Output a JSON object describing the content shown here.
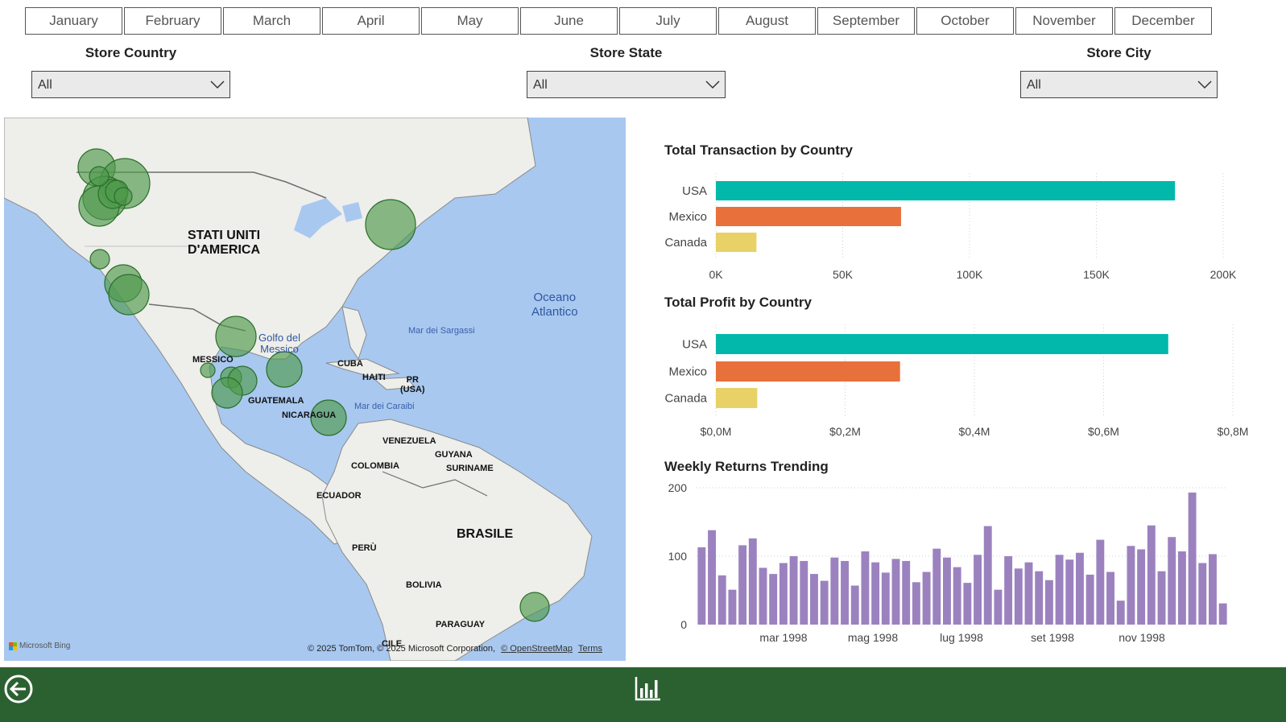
{
  "months": [
    "January",
    "February",
    "March",
    "April",
    "May",
    "June",
    "July",
    "August",
    "September",
    "October",
    "November",
    "December"
  ],
  "slicers": [
    {
      "title": "Store Country",
      "value": "All"
    },
    {
      "title": "Store State",
      "value": "All"
    },
    {
      "title": "Store City",
      "value": "All"
    }
  ],
  "map": {
    "labels": {
      "usa_line1": "STATI UNITI",
      "usa_line2": "D'AMERICA",
      "ocean_line1": "Oceano",
      "ocean_line2": "Atlantico",
      "gulf_line1": "Golfo del",
      "gulf_line2": "Messico",
      "sargasso": "Mar dei Sargassi",
      "caribbean": "Mar dei Caraibi",
      "mexico": "MESSICO",
      "cuba": "CUBA",
      "haiti": "HAITI",
      "pr_line1": "PR",
      "pr_line2": "(USA)",
      "guatemala": "GUATEMALA",
      "nicaragua": "NICARAGUA",
      "venezuela": "VENEZUELA",
      "guyana": "GUYANA",
      "suriname": "SURINAME",
      "colombia": "COLOMBIA",
      "ecuador": "ECUADOR",
      "brazil": "BRASILE",
      "peru": "PERÙ",
      "bolivia": "BOLIVIA",
      "paraguay": "PARAGUAY",
      "chile": "CILE"
    },
    "bing_label": "Microsoft Bing",
    "copyright": "© 2025 TomTom, © 2025 Microsoft Corporation,",
    "osm_link": "© OpenStreetMap",
    "terms_link": "Terms",
    "bubble_color": "#4e9a4b"
  },
  "chart_data": [
    {
      "type": "bar",
      "orientation": "horizontal",
      "title": "Total Transaction by Country",
      "categories": [
        "USA",
        "Mexico",
        "Canada"
      ],
      "values": [
        181000,
        73000,
        16000
      ],
      "colors": [
        "#01b8aa",
        "#e8703a",
        "#e8d166"
      ],
      "xlim": [
        0,
        200000
      ],
      "ticks": [
        "0K",
        "50K",
        "100K",
        "150K",
        "200K"
      ]
    },
    {
      "type": "bar",
      "orientation": "horizontal",
      "title": "Total Profit by Country",
      "categories": [
        "USA",
        "Mexico",
        "Canada"
      ],
      "values": [
        0.7,
        0.285,
        0.064
      ],
      "colors": [
        "#01b8aa",
        "#e8703a",
        "#e8d166"
      ],
      "xlim": [
        0,
        0.8
      ],
      "ticks": [
        "$0,0M",
        "$0,2M",
        "$0,4M",
        "$0,6M",
        "$0,8M"
      ]
    },
    {
      "type": "bar",
      "title": "Weekly Returns Trending",
      "color": "#9b82bf",
      "ylim": [
        0,
        200
      ],
      "yticks": [
        "0",
        "100",
        "200"
      ],
      "x_tick_labels": [
        "mar 1998",
        "mag 1998",
        "lug 1998",
        "set 1998",
        "nov 1998"
      ],
      "values": [
        113,
        138,
        72,
        51,
        116,
        126,
        83,
        74,
        90,
        100,
        93,
        74,
        64,
        98,
        93,
        57,
        107,
        91,
        76,
        96,
        93,
        62,
        77,
        111,
        98,
        84,
        61,
        102,
        144,
        51,
        100,
        82,
        91,
        78,
        65,
        102,
        95,
        105,
        73,
        124,
        77,
        35,
        115,
        110,
        145,
        78,
        128,
        107,
        193,
        90,
        103,
        31
      ]
    }
  ]
}
